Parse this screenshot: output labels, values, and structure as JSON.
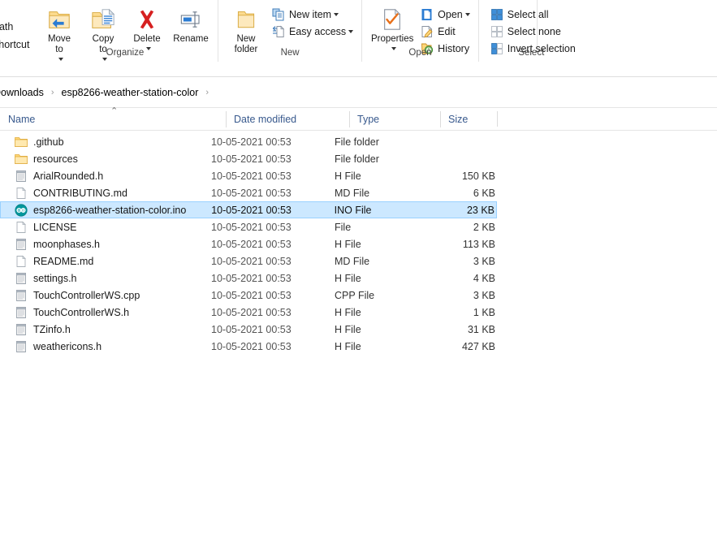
{
  "ribbon": {
    "clipped_labels": [
      "path",
      "shortcut"
    ],
    "groups": [
      {
        "label": "Organize",
        "large_buttons": [
          {
            "label": "Move\nto",
            "icon": "move-to-icon",
            "has_caret": true
          },
          {
            "label": "Copy\nto",
            "icon": "copy-to-icon",
            "has_caret": true
          },
          {
            "label": "Delete",
            "icon": "delete-icon",
            "has_caret": true
          },
          {
            "label": "Rename",
            "icon": "rename-icon",
            "has_caret": false
          }
        ]
      },
      {
        "label": "New",
        "large_buttons": [
          {
            "label": "New\nfolder",
            "icon": "new-folder-icon",
            "has_caret": false
          }
        ],
        "small_buttons": [
          {
            "label": "New item",
            "icon": "new-item-icon",
            "has_caret": true
          },
          {
            "label": "Easy access",
            "icon": "easy-access-icon",
            "has_caret": true
          }
        ]
      },
      {
        "label": "Open",
        "large_buttons": [
          {
            "label": "Properties",
            "icon": "properties-icon",
            "has_caret": true
          }
        ],
        "small_buttons": [
          {
            "label": "Open",
            "icon": "open-icon",
            "has_caret": true
          },
          {
            "label": "Edit",
            "icon": "edit-icon",
            "has_caret": false
          },
          {
            "label": "History",
            "icon": "history-icon",
            "has_caret": false
          }
        ]
      },
      {
        "label": "Select",
        "small_buttons": [
          {
            "label": "Select all",
            "icon": "select-all-icon",
            "has_caret": false
          },
          {
            "label": "Select none",
            "icon": "select-none-icon",
            "has_caret": false
          },
          {
            "label": "Invert selection",
            "icon": "invert-selection-icon",
            "has_caret": false
          }
        ]
      }
    ]
  },
  "breadcrumb": {
    "items": [
      "Downloads",
      "esp8266-weather-station-color"
    ],
    "separator": "›"
  },
  "columns": [
    {
      "label": "Name",
      "sorted": true,
      "sort_glyph": "⌃"
    },
    {
      "label": "Date modified",
      "sorted": false
    },
    {
      "label": "Type",
      "sorted": false
    },
    {
      "label": "Size",
      "sorted": false
    }
  ],
  "files": [
    {
      "name": ".github",
      "date": "10-05-2021 00:53",
      "type": "File folder",
      "size": "",
      "icon": "folder-icon",
      "selected": false
    },
    {
      "name": "resources",
      "date": "10-05-2021 00:53",
      "type": "File folder",
      "size": "",
      "icon": "folder-icon",
      "selected": false
    },
    {
      "name": "ArialRounded.h",
      "date": "10-05-2021 00:53",
      "type": "H File",
      "size": "150 KB",
      "icon": "h-file-icon",
      "selected": false
    },
    {
      "name": "CONTRIBUTING.md",
      "date": "10-05-2021 00:53",
      "type": "MD File",
      "size": "6 KB",
      "icon": "generic-file-icon",
      "selected": false
    },
    {
      "name": "esp8266-weather-station-color.ino",
      "date": "10-05-2021 00:53",
      "type": "INO File",
      "size": "23 KB",
      "icon": "arduino-ino-icon",
      "selected": true
    },
    {
      "name": "LICENSE",
      "date": "10-05-2021 00:53",
      "type": "File",
      "size": "2 KB",
      "icon": "generic-file-icon",
      "selected": false
    },
    {
      "name": "moonphases.h",
      "date": "10-05-2021 00:53",
      "type": "H File",
      "size": "113 KB",
      "icon": "h-file-icon",
      "selected": false
    },
    {
      "name": "README.md",
      "date": "10-05-2021 00:53",
      "type": "MD File",
      "size": "3 KB",
      "icon": "generic-file-icon",
      "selected": false
    },
    {
      "name": "settings.h",
      "date": "10-05-2021 00:53",
      "type": "H File",
      "size": "4 KB",
      "icon": "h-file-icon",
      "selected": false
    },
    {
      "name": "TouchControllerWS.cpp",
      "date": "10-05-2021 00:53",
      "type": "CPP File",
      "size": "3 KB",
      "icon": "h-file-icon",
      "selected": false
    },
    {
      "name": "TouchControllerWS.h",
      "date": "10-05-2021 00:53",
      "type": "H File",
      "size": "1 KB",
      "icon": "h-file-icon",
      "selected": false
    },
    {
      "name": "TZinfo.h",
      "date": "10-05-2021 00:53",
      "type": "H File",
      "size": "31 KB",
      "icon": "h-file-icon",
      "selected": false
    },
    {
      "name": "weathericons.h",
      "date": "10-05-2021 00:53",
      "type": "H File",
      "size": "427 KB",
      "icon": "h-file-icon",
      "selected": false
    }
  ],
  "colors": {
    "selection_fill": "#cce8ff",
    "selection_border": "#99d1ff",
    "column_header_text": "#38598d",
    "folder_yellow": "#ffd675",
    "arduino_teal": "#00979c",
    "delete_red": "#d62020",
    "accent_blue": "#2b7cd3",
    "properties_orange": "#e8701a"
  }
}
